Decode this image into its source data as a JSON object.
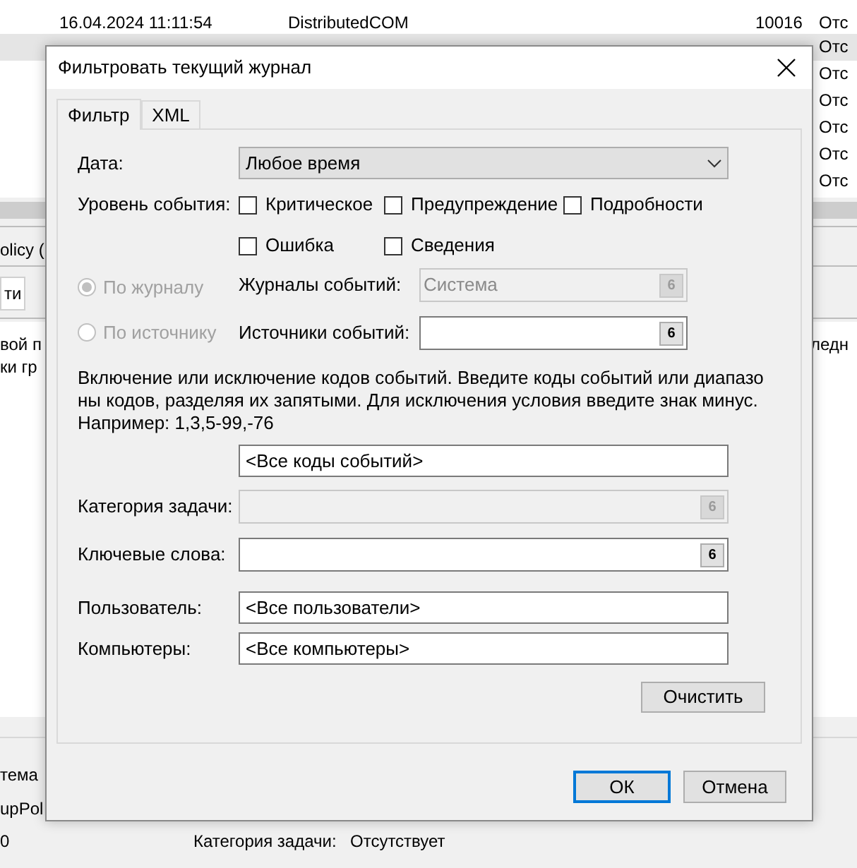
{
  "background": {
    "top_row": {
      "date": "16.04.2024 11:11:54",
      "source": "DistributedCOM",
      "event_id": "10016",
      "status": "Отс"
    },
    "right_column": [
      "Отс",
      "Отс",
      "Отс",
      "Отс",
      "Отс",
      "Отс"
    ],
    "left_fragments": [
      "olicy (",
      "ти",
      "вой п",
      "ки гр"
    ],
    "right_fragment": "ледн",
    "bottom_fragments": [
      "тема",
      "upPol",
      "0"
    ],
    "bottom_detail": {
      "label": "Категория задачи:",
      "value": "Отсутствует"
    }
  },
  "dialog": {
    "title": "Фильтровать текущий журнал",
    "tabs": [
      {
        "label": "Фильтр",
        "selected": true
      },
      {
        "label": "XML",
        "selected": false
      }
    ],
    "date": {
      "label": "Дата:",
      "value": "Любое время"
    },
    "event_level": {
      "label": "Уровень события:",
      "options": [
        {
          "label": "Критическое",
          "checked": false
        },
        {
          "label": "Предупреждение",
          "checked": false
        },
        {
          "label": "Подробности",
          "checked": false
        },
        {
          "label": "Ошибка",
          "checked": false
        },
        {
          "label": "Сведения",
          "checked": false
        }
      ]
    },
    "radios": [
      {
        "label": "По журналу",
        "selected": true,
        "disabled": true
      },
      {
        "label": "По источнику",
        "selected": false,
        "disabled": true
      }
    ],
    "logs": {
      "label": "Журналы событий:",
      "value": "Система",
      "disabled": true,
      "picker": "6"
    },
    "sources": {
      "label": "Источники событий:",
      "disabled": false,
      "picker": "6"
    },
    "description": "Включение или исключение кодов событий. Введите коды событий или диапазоны кодов, разделяя их запятыми. Для исключения условия введите знак минус. Например: 1,3,5-99,-76",
    "event_ids": {
      "value": "<Все коды событий>"
    },
    "task_category": {
      "label": "Категория задачи:",
      "disabled": true,
      "picker": "6"
    },
    "keywords": {
      "label": "Ключевые слова:",
      "disabled": false,
      "picker": "6"
    },
    "user": {
      "label": "Пользователь:",
      "value": "<Все пользователи>"
    },
    "computers": {
      "label": "Компьютеры:",
      "value": "<Все компьютеры>"
    },
    "clear_button": "Очистить",
    "ok_button": "ОК",
    "cancel_button": "Отмена"
  }
}
